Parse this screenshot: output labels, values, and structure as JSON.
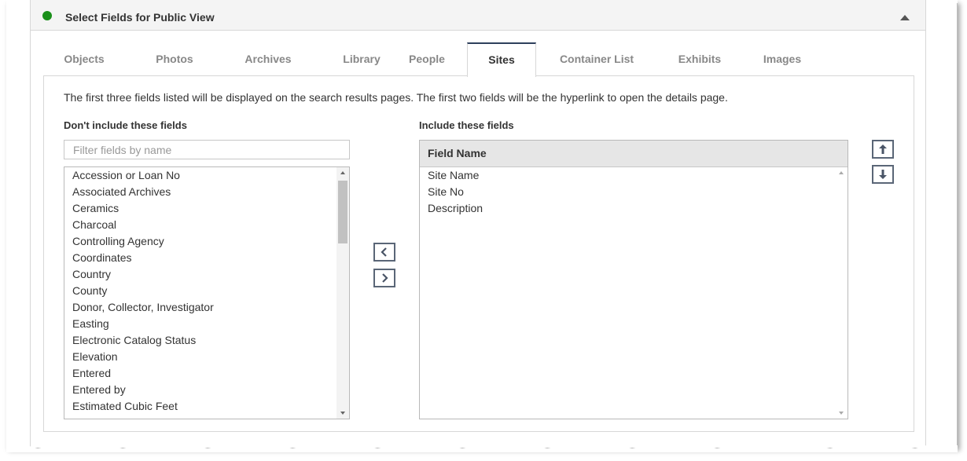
{
  "panel": {
    "title": "Select Fields for Public View",
    "status_color": "#1a8f1a"
  },
  "tabs": [
    {
      "label": "Objects"
    },
    {
      "label": "Photos"
    },
    {
      "label": "Archives"
    },
    {
      "label": "Library"
    },
    {
      "label": "People"
    },
    {
      "label": "Sites",
      "active": true
    },
    {
      "label": "Container List"
    },
    {
      "label": "Exhibits"
    },
    {
      "label": "Images"
    }
  ],
  "info_text": "The first three fields listed will be displayed on the search results pages. The first two fields will be the hyperlink to open the details page.",
  "excluded": {
    "label": "Don't include these fields",
    "filter_placeholder": "Filter fields by name",
    "items": [
      "Accession or Loan No",
      "Associated Archives",
      "Ceramics",
      "Charcoal",
      "Controlling Agency",
      "Coordinates",
      "Country",
      "County",
      "Donor, Collector, Investigator",
      "Easting",
      "Electronic Catalog Status",
      "Elevation",
      "Entered",
      "Entered by",
      "Estimated Cubic Feet"
    ]
  },
  "included": {
    "label": "Include these fields",
    "column_header": "Field Name",
    "items": [
      "Site Name",
      "Site No",
      "Description"
    ]
  },
  "buttons": {
    "move_left_icon": "chevron-left-icon",
    "move_right_icon": "chevron-right-icon",
    "move_up_icon": "arrow-up-icon",
    "move_down_icon": "arrow-down-icon"
  }
}
